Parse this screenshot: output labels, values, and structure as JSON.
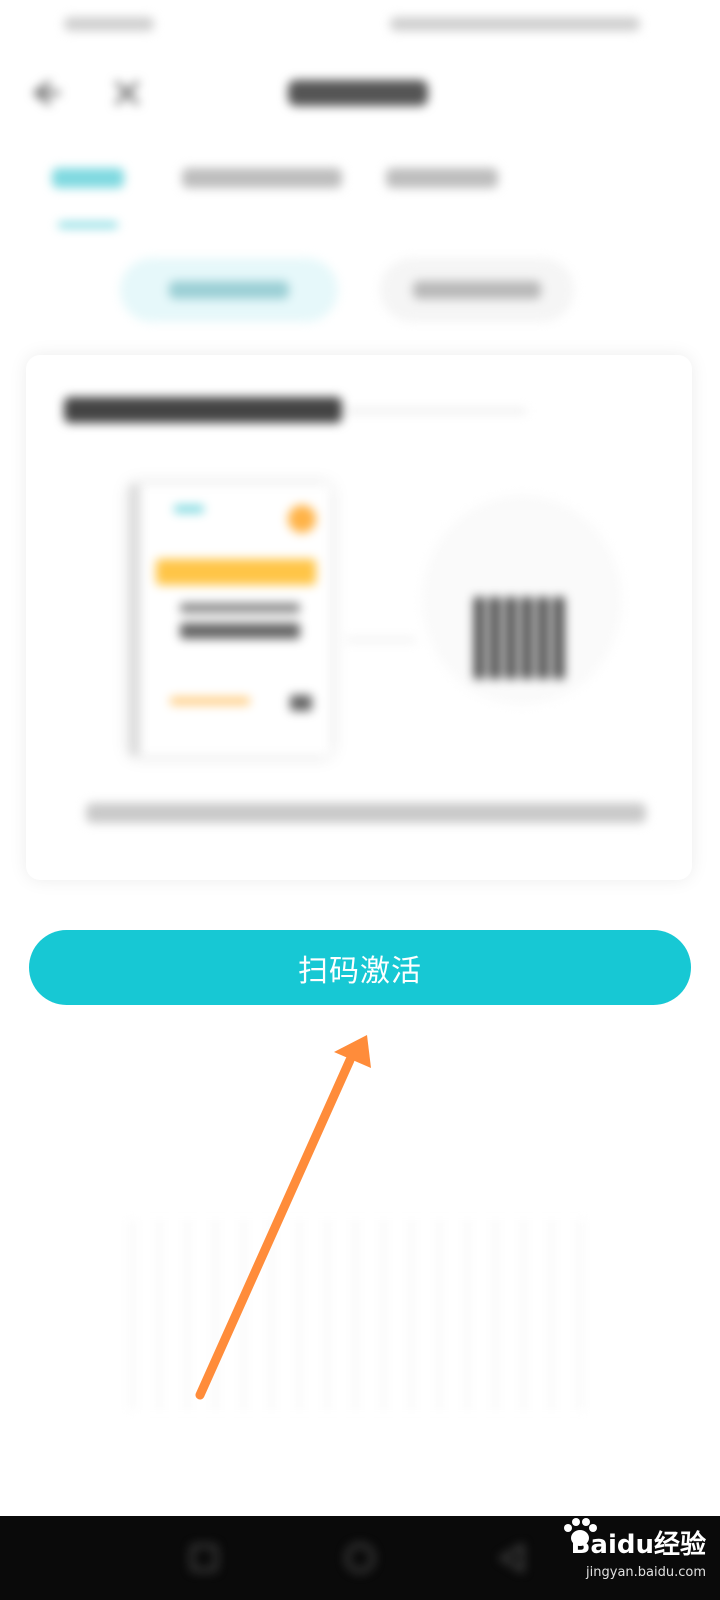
{
  "colors": {
    "accent": "#17c8d4",
    "arrow": "#ff8c3a",
    "navbar": "#0a0a0a"
  },
  "icons": {
    "back": "back-arrow-icon",
    "close": "close-icon",
    "nav_square": "recent-apps-icon",
    "nav_circle": "home-icon",
    "nav_triangle": "back-nav-icon"
  },
  "main": {
    "activate_button_label": "扫码激活"
  },
  "watermark": {
    "brand": "Baidu经验",
    "domain": "jingyan.baidu.com"
  }
}
